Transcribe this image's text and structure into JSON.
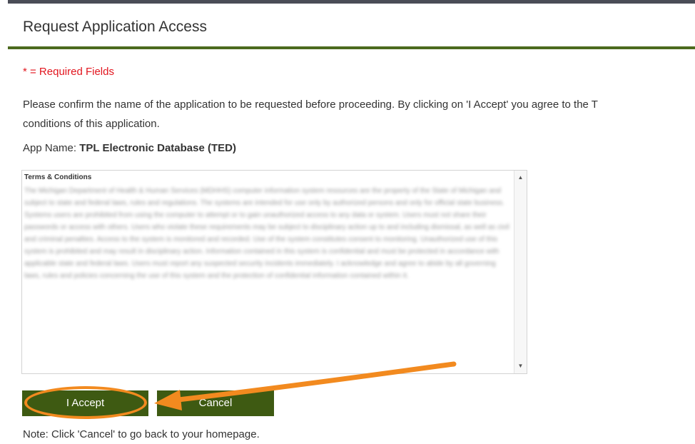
{
  "page": {
    "title": "Request Application Access",
    "required_note": "* = Required Fields",
    "intro_line1": "Please confirm the name of the application to be requested before proceeding. By clicking on 'I Accept' you agree to the T",
    "intro_line2": "conditions of this application."
  },
  "app": {
    "label": "App Name:",
    "value": "TPL Electronic Database (TED)"
  },
  "terms": {
    "title": "Terms & Conditions",
    "body": "The Michigan Department of Health & Human Services (MDHHS) computer information system resources are the property of the State of Michigan and subject to state and federal laws, rules and regulations. The systems are intended for use only by authorized persons and only for official state business. Systems users are prohibited from using the computer to attempt or to gain unauthorized access to any data or system. Users must not share their passwords or access with others. Users who violate these requirements may be subject to disciplinary action up to and including dismissal, as well as civil and criminal penalties. Access to the system is monitored and recorded. Use of the system constitutes consent to monitoring. Unauthorized use of this system is prohibited and may result in disciplinary action. Information contained in this system is confidential and must be protected in accordance with applicable state and federal laws. Users must report any suspected security incidents immediately. I acknowledge and agree to abide by all governing laws, rules and policies concerning the use of this system and the protection of confidential information contained within it."
  },
  "buttons": {
    "accept": "I Accept",
    "cancel": "Cancel"
  },
  "note": "Note: Click 'Cancel' to go back to your homepage.",
  "colors": {
    "accent_green": "#3e5a12",
    "rule_green": "#4c6a1e",
    "required_red": "#e2161f",
    "annotation_orange": "#f28a1f"
  }
}
